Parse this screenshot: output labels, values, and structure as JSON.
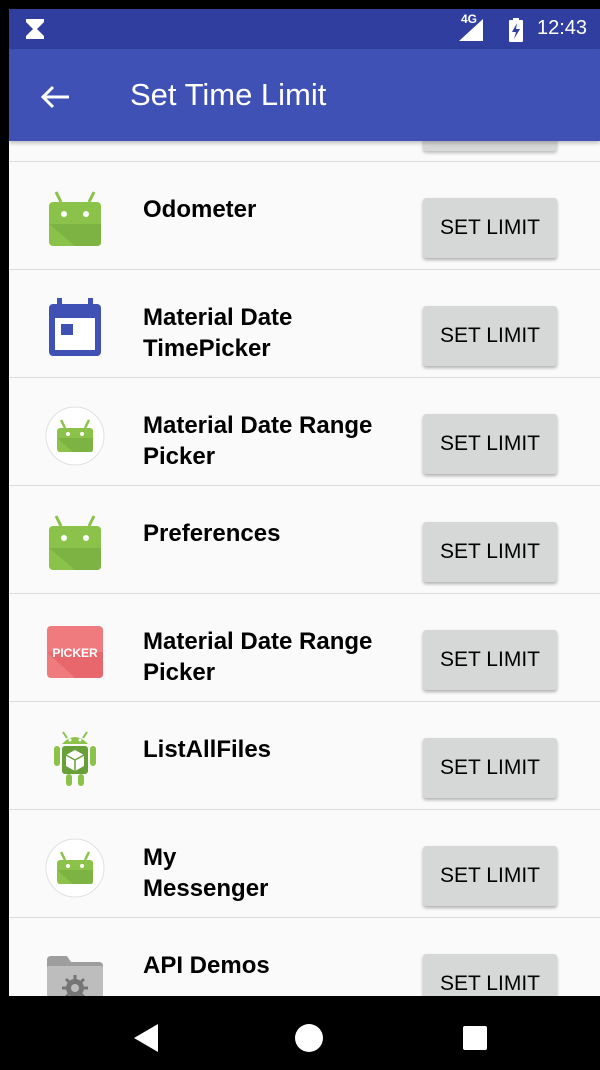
{
  "status_bar": {
    "network": "4G",
    "time": "12:43"
  },
  "app_bar": {
    "title": "Set Time Limit"
  },
  "apps": [
    {
      "name": "Odometer",
      "icon": "android-robot-icon",
      "button": "SET LIMIT"
    },
    {
      "name": "Material Date TimePicker",
      "icon": "calendar-icon",
      "button": "SET LIMIT"
    },
    {
      "name": "Material Date Range Picker",
      "icon": "android-robot-round-icon",
      "button": "SET LIMIT"
    },
    {
      "name": "Preferences",
      "icon": "android-robot-icon",
      "button": "SET LIMIT"
    },
    {
      "name": "Material Date Range Picker",
      "icon": "picker-icon",
      "icon_text": "PICKER",
      "button": "SET LIMIT"
    },
    {
      "name": "ListAllFiles",
      "icon": "android-box-icon",
      "button": "SET LIMIT"
    },
    {
      "name": "My Messenger",
      "icon": "android-robot-round-icon",
      "button": "SET LIMIT"
    },
    {
      "name": "API Demos",
      "icon": "folder-gear-icon",
      "button": "SET LIMIT"
    }
  ],
  "colors": {
    "status_bar": "#303f9f",
    "app_bar": "#3f51b5",
    "android_green": "#8bc34a",
    "calendar_blue": "#3f51b5",
    "picker_red": "#f07b7f",
    "button_gray": "#d6d7d7"
  },
  "nav": {
    "back": "back-triangle-icon",
    "home": "home-circle-icon",
    "recents": "recents-square-icon"
  }
}
